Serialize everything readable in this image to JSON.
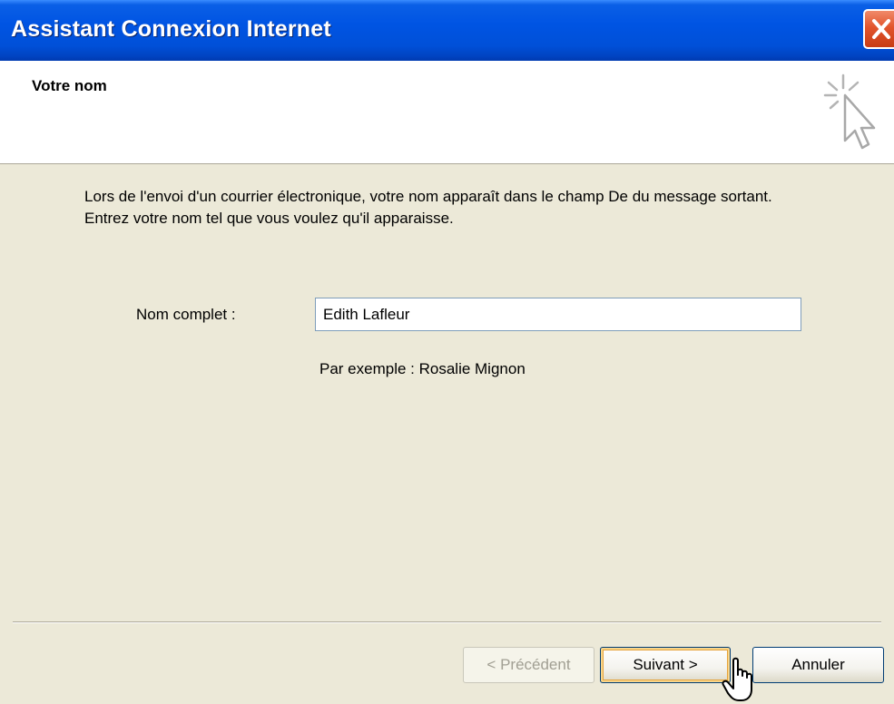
{
  "window": {
    "title": "Assistant Connexion Internet"
  },
  "header": {
    "title": "Votre nom",
    "icon": "wizard-pointer-icon"
  },
  "body": {
    "description": "Lors de l'envoi d'un courrier électronique, votre nom apparaît dans le champ De du message sortant. Entrez votre nom tel que vous voulez qu'il apparaisse.",
    "name_label": "Nom complet :",
    "name_value": "Edith Lafleur",
    "example": "Par exemple : Rosalie Mignon"
  },
  "buttons": {
    "previous": "< Précédent",
    "next": "Suivant >",
    "cancel": "Annuler"
  },
  "colors": {
    "titlebar": "#0054e3",
    "close": "#e2542c",
    "dialog_bg": "#ece9d8"
  }
}
